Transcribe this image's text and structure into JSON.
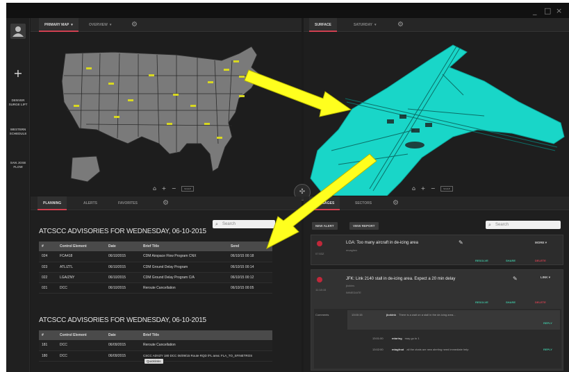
{
  "window_controls": {
    "minimize": "_",
    "maximize": "□",
    "close": "×"
  },
  "rail": {
    "user_icon": "user-icon",
    "add_icon": "plus-icon",
    "items": [
      {
        "label": "DENVER SURGE LIFT"
      },
      {
        "label": "WESTERN SCHEDULE"
      },
      {
        "label": "SAN JOSE FLOW"
      }
    ]
  },
  "left_tabs": [
    {
      "label": "PRIMARY MAP"
    },
    {
      "label": "OVERVIEW"
    }
  ],
  "right_tabs": [
    {
      "label": "SURFACE"
    },
    {
      "label": "SATURDAY"
    }
  ],
  "bottom_left_tabs": [
    {
      "label": "PLANNING"
    },
    {
      "label": "ALERTS"
    },
    {
      "label": "FAVORITES"
    }
  ],
  "bottom_right_tabs": [
    {
      "label": "MESSAGES"
    },
    {
      "label": "SECTORS"
    }
  ],
  "left_map_toolbar": {
    "home": "⌂",
    "zoom_in": "+",
    "zoom_out": "−",
    "scale": "SCALE"
  },
  "right_map_toolbar": {
    "home": "⌂",
    "zoom_in": "+",
    "zoom_out": "−",
    "scale": "SCALE"
  },
  "advisories": [
    {
      "title": "ATCSCC ADVISORIES FOR WEDNESDAY, 06-10-2015",
      "search_placeholder": "Search",
      "columns": [
        "#",
        "Control Element",
        "Date",
        "Brief Title",
        "Send"
      ],
      "rows": [
        [
          "024",
          "FCA418",
          "06/10/2015",
          "CDM Airspace Flow Program CNX",
          "06/10/15 00:18"
        ],
        [
          "023",
          "ATL/ZTL",
          "06/10/2015",
          "CDM Ground Delay Program",
          "06/10/15 00:14"
        ],
        [
          "022",
          "LGA/ZNY",
          "06/10/2015",
          "CDM Ground Delay Program C/A",
          "06/10/15 00:12"
        ],
        [
          "021",
          "DCC",
          "06/10/2015",
          "Reroute Cancellation",
          "06/10/15 00:05"
        ]
      ]
    },
    {
      "title": "ATCSCC ADVISORIES FOR WEDNESDAY, 06-10-2015",
      "columns": [
        "#",
        "Control Element",
        "Date",
        "Brief Title"
      ],
      "rows": [
        [
          "181",
          "DCC",
          "06/09/2015",
          "Reroute Cancellation"
        ],
        [
          "180",
          "DCC",
          "06/09/2015",
          "CSCC ADVZY 180 DCC 06/09/15 Route RQD /FL area: FLA_TO_SFINETROS"
        ]
      ]
    }
  ],
  "tooltip": "Quicklinks",
  "message_buttons": {
    "new_alert": "NEW ALERT",
    "view_report": "VIEW REPORT",
    "search_placeholder": "Search"
  },
  "cards": [
    {
      "title": "LGA: Too many aircraft in de-icing area",
      "author": "mvaghez",
      "time": "07:53Z",
      "dropdown": "MORE",
      "actions": [
        "RESOLVE",
        "SHARE",
        "DELETE"
      ]
    },
    {
      "title": "JFK: Link 2140 stall in de-icing area. Expect a 20 min delay",
      "author": "jkokins",
      "time": "11:18:15",
      "status": "IMMEDIATE",
      "dropdown": "LINK",
      "actions": [
        "RESOLVE",
        "SHARE",
        "DELETE"
      ],
      "thread_label": "Comments",
      "thread": [
        {
          "time": "13:00:15",
          "user": "jkokinb",
          "text": "There is a wait on a stall in the de-icing area...",
          "action": "REPLY"
        },
        {
          "time": "13:01:00",
          "user": "mtaring",
          "text": "may go to 1",
          "action": ""
        },
        {
          "time": "13:02:00",
          "user": "mtagfrod",
          "text": "all the chats are new alerting need immediate help",
          "action": "REPLY"
        }
      ]
    }
  ],
  "colors": {
    "accent": "#d04050",
    "teal": "#19d6c8",
    "arrow": "#ffff1e",
    "map_land": "#787878"
  }
}
